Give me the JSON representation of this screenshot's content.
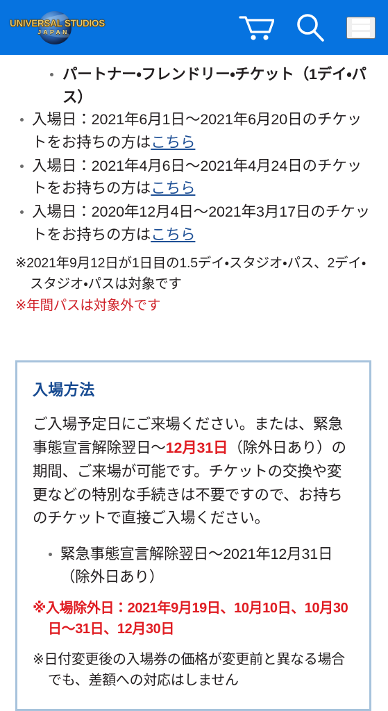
{
  "header": {
    "logo": {
      "main_text": "UNIVERSAL STUDIOS",
      "sub_text": "JAPAN",
      "alt": "Universal Studios Japan"
    },
    "icons": [
      {
        "name": "cart-icon",
        "label": "カート"
      },
      {
        "name": "search-icon",
        "label": "検索"
      },
      {
        "name": "menu-icon",
        "label": "メニュー"
      }
    ],
    "background_color": "#0673e0"
  },
  "ticket_list": {
    "nested_item": "パートナー・フレンドリー・チケット（1デイ・パス）",
    "items": [
      {
        "text_before": "入場日：2021年6月1日〜2021年6月20日のチケットをお持ちの方は",
        "link_label": "こちら"
      },
      {
        "text_before": "入場日：2021年4月6日〜2021年4月24日のチケットをお持ちの方は",
        "link_label": "こちら"
      },
      {
        "text_before": "入場日：2020年12月4日〜2021年3月17日のチケットをお持ちの方は",
        "link_label": "こちら"
      }
    ]
  },
  "notes": [
    {
      "text": "※2021年9月12日が1日目の1.5デイ・スタジオ・パス、2デイ・スタジオ・パスは対象です",
      "color": "#231f20"
    },
    {
      "text": "※年間パスは対象外です",
      "color": "#cf1f26"
    }
  ],
  "info_box": {
    "title": "入場方法",
    "paragraph": {
      "part1": "ご入場予定日にご来場ください。または、緊急事態宣言解除翌日〜",
      "highlight": "12月31日",
      "part2": "（除外日あり）の期間、ご来場が可能です。チケットの交換や変更などの特別な手続きは不要ですので、お持ちのチケットで直接ご入場ください。"
    },
    "bullets": [
      "緊急事態宣言解除翌日〜2021年12月31日（除外日あり）"
    ],
    "notes": [
      {
        "text": "※入場除外日：2021年9月19日、10月10日、10月30日〜31日、12月30日",
        "color": "#e01c22",
        "bold": true
      },
      {
        "text": "※日付変更後の入場券の価格が変更前と異なる場合でも、差額への対応はしません",
        "color": "#231f20",
        "bold": false
      }
    ],
    "border_color": "#a7c3dc",
    "title_color": "#164a91"
  }
}
